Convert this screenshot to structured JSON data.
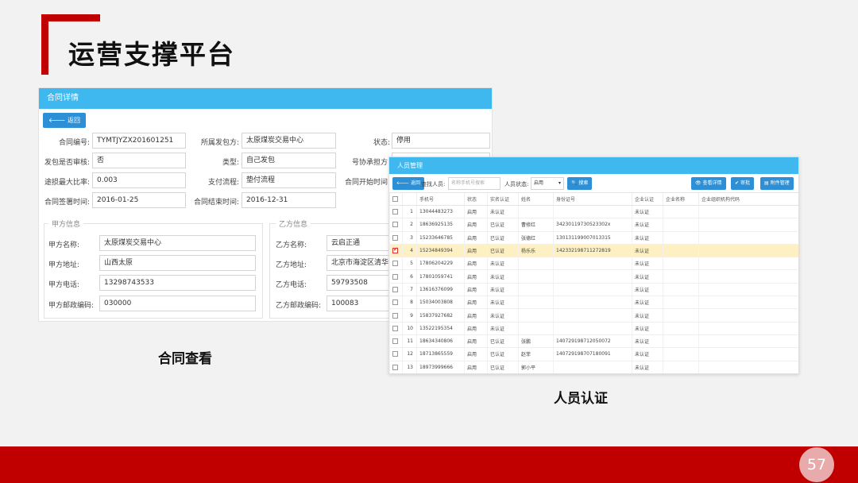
{
  "slide": {
    "title": "运营支撑平台",
    "page_number": "57",
    "caption_contract": "合同查看",
    "caption_personnel": "人员认证"
  },
  "contract": {
    "window_title": "合同详情",
    "back_button": "返回",
    "fields": {
      "contract_no_label": "合同编号:",
      "contract_no": "TYMTJYZX201601251",
      "issuer_label": "所属发包方:",
      "issuer": "太原煤炭交易中心",
      "status_label": "状态:",
      "status": "停用",
      "audit_label": "发包是否审核:",
      "audit": "否",
      "type_label": "类型:",
      "type": "自己发包",
      "contractor_label": "号协承担方:",
      "contractor": "",
      "ratio_label": "途损最大比率:",
      "ratio": "0.003",
      "payflow_label": "支付流程:",
      "payflow": "垫付流程",
      "start_label": "合同开始时间:",
      "start": "",
      "sign_label": "合同签署时间:",
      "sign": "2016-01-25",
      "end_label": "合同结束时间:",
      "end": "2016-12-31"
    },
    "party_a": {
      "legend": "甲方信息",
      "name_label": "甲方名称:",
      "name": "太原煤炭交易中心",
      "address_label": "甲方地址:",
      "address": "山西太原",
      "phone_label": "甲方电话:",
      "phone": "13298743533",
      "zip_label": "甲方邮政编码:",
      "zip": "030000"
    },
    "party_b": {
      "legend": "乙方信息",
      "name_label": "乙方名称:",
      "name": "云启正通",
      "address_label": "乙方地址:",
      "address": "北京市海淀区清华东",
      "phone_label": "乙方电话:",
      "phone": "59793508",
      "zip_label": "乙方邮政编码:",
      "zip": "100083"
    }
  },
  "personnel": {
    "window_title": "人员管理",
    "back_button": "返回",
    "search_label": "查找人员:",
    "search_placeholder": "名称手机号搜索",
    "status_label": "人员状态:",
    "status_value": "启用",
    "search_button": "搜索",
    "view_button": "查看详情",
    "approve_button": "审批",
    "document_button": "附件管理",
    "columns": [
      "",
      "",
      "手机号",
      "状态",
      "实名认证",
      "姓名",
      "身份证号",
      "企业认证",
      "企业名称",
      "企业组织机构代码"
    ],
    "rows": [
      {
        "n": "1",
        "phone": "13044483273",
        "state": "启用",
        "realname": "未认证",
        "name": "",
        "id": "",
        "corp": "未认证",
        "checked": false
      },
      {
        "n": "2",
        "phone": "18636925135",
        "state": "启用",
        "realname": "已认证",
        "name": "曹修红",
        "id": "34230119730523302x",
        "corp": "未认证",
        "checked": false
      },
      {
        "n": "3",
        "phone": "15233646785",
        "state": "启用",
        "realname": "已认证",
        "name": "张德红",
        "id": "130131199007013315",
        "corp": "未认证",
        "checked": false
      },
      {
        "n": "4",
        "phone": "15234849394",
        "state": "启用",
        "realname": "已认证",
        "name": "杨乐乐",
        "id": "142332198711272819",
        "corp": "未认证",
        "checked": true
      },
      {
        "n": "5",
        "phone": "17806204229",
        "state": "启用",
        "realname": "未认证",
        "name": "",
        "id": "",
        "corp": "未认证",
        "checked": false
      },
      {
        "n": "6",
        "phone": "17801059741",
        "state": "启用",
        "realname": "未认证",
        "name": "",
        "id": "",
        "corp": "未认证",
        "checked": false
      },
      {
        "n": "7",
        "phone": "13616376099",
        "state": "启用",
        "realname": "未认证",
        "name": "",
        "id": "",
        "corp": "未认证",
        "checked": false
      },
      {
        "n": "8",
        "phone": "15034003808",
        "state": "启用",
        "realname": "未认证",
        "name": "",
        "id": "",
        "corp": "未认证",
        "checked": false
      },
      {
        "n": "9",
        "phone": "15837927682",
        "state": "启用",
        "realname": "未认证",
        "name": "",
        "id": "",
        "corp": "未认证",
        "checked": false
      },
      {
        "n": "10",
        "phone": "13522195354",
        "state": "启用",
        "realname": "未认证",
        "name": "",
        "id": "",
        "corp": "未认证",
        "checked": false
      },
      {
        "n": "11",
        "phone": "18634340806",
        "state": "启用",
        "realname": "已认证",
        "name": "张鹏",
        "id": "140729198712050072",
        "corp": "未认证",
        "checked": false
      },
      {
        "n": "12",
        "phone": "18713865559",
        "state": "启用",
        "realname": "已认证",
        "name": "赵菲",
        "id": "140729198707180091",
        "corp": "未认证",
        "checked": false
      },
      {
        "n": "13",
        "phone": "18973999666",
        "state": "启用",
        "realname": "已认证",
        "name": "郭小平",
        "id": "",
        "corp": "未认证",
        "checked": false
      }
    ]
  },
  "colors": {
    "accent_red": "#c00000",
    "titlebar_blue": "#3eb8ef",
    "button_blue": "#2d8fd5",
    "verified_green": "#2aa52a",
    "unverified_red": "#e02020",
    "highlight_row": "#fdf0c2"
  },
  "icons": {
    "back": "arrow-left-icon",
    "search": "search-icon",
    "view": "eye-icon",
    "approve": "check-icon",
    "document": "document-icon"
  }
}
